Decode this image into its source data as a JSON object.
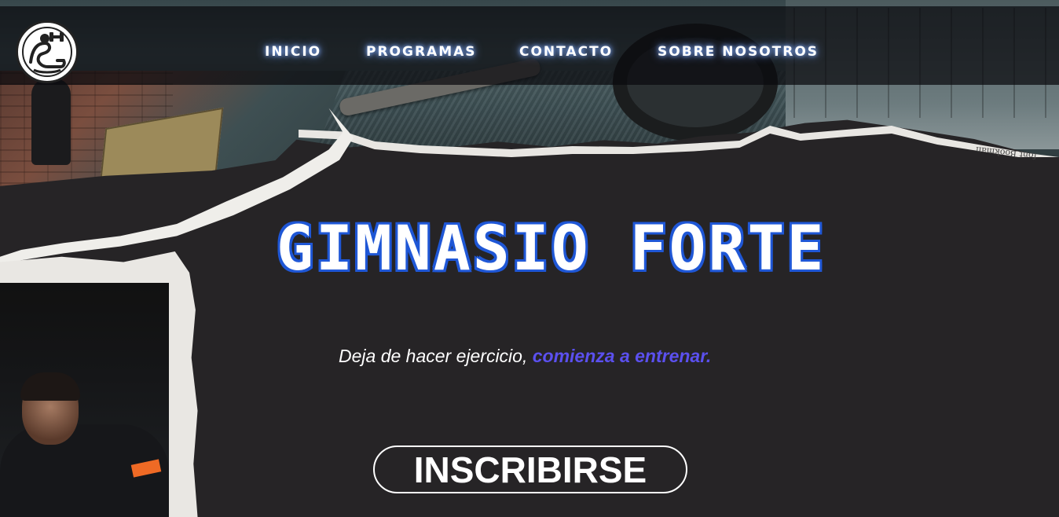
{
  "app": {
    "logo_icon": "bodybuilder-dumbbell-icon"
  },
  "nav": {
    "items": [
      {
        "label": "INICIO"
      },
      {
        "label": "PROGRAMAS"
      },
      {
        "label": "CONTACTO"
      },
      {
        "label": "SOBRE NOSOTROS"
      }
    ]
  },
  "hero": {
    "title": "GIMNASIO FORTE",
    "tagline_main": "Deja de hacer ejercicio, ",
    "tagline_accent": "comienza a entrenar.",
    "cta_label": "INSCRIBIRSE"
  },
  "decor": {
    "newsprint_text": "font Bookman"
  },
  "colors": {
    "background": "#262426",
    "title_outline": "#1f57d6",
    "accent": "#5b50ef",
    "nav_glow": "#8ab4ff"
  }
}
